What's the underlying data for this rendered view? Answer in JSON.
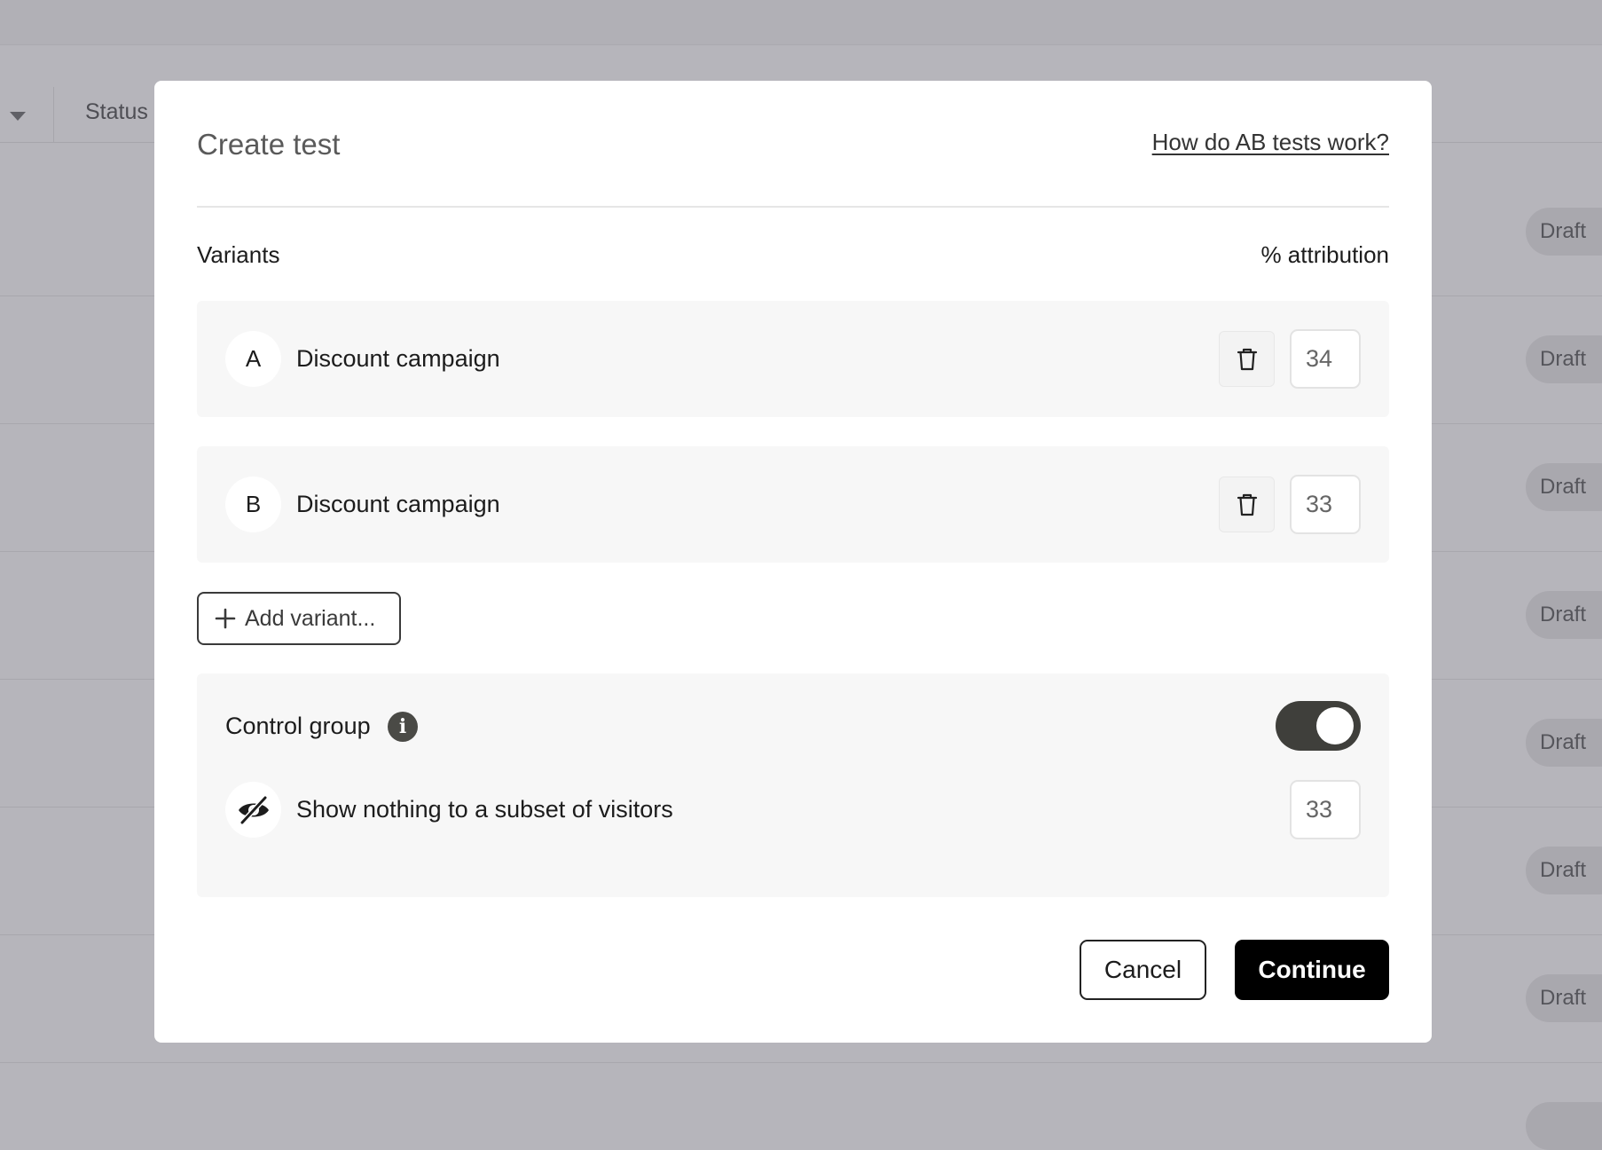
{
  "background": {
    "status_header": "Status",
    "badges": [
      "Draft",
      "Draft",
      "Draft",
      "Draft",
      "Draft",
      "Draft",
      "Draft"
    ]
  },
  "modal": {
    "title": "Create test",
    "help_link": "How do AB tests work?",
    "variants_label": "Variants",
    "attribution_label": "% attribution",
    "variants": [
      {
        "letter": "A",
        "name": "Discount campaign",
        "attribution": "34"
      },
      {
        "letter": "B",
        "name": "Discount campaign",
        "attribution": "33"
      }
    ],
    "add_variant_label": "Add variant...",
    "control_group": {
      "label": "Control group",
      "enabled": true,
      "description": "Show nothing to a subset of visitors",
      "attribution": "33"
    },
    "cancel_label": "Cancel",
    "continue_label": "Continue"
  }
}
